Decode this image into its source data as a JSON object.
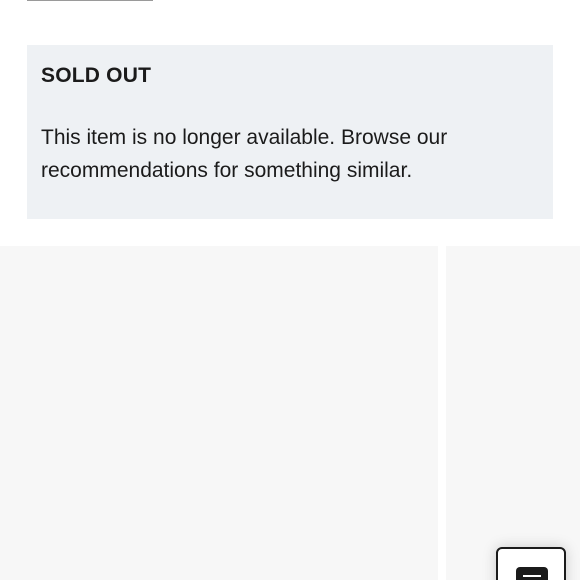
{
  "notice": {
    "title": "SOLD OUT",
    "message": "This item is no longer available. Browse our recommendations for something similar."
  },
  "recommendations": {
    "cards": [
      {
        "id": "rec-1"
      },
      {
        "id": "rec-2"
      }
    ]
  },
  "menu_button": {
    "icon": "menu-list-icon"
  },
  "colors": {
    "notice_background": "#eef1f4",
    "card_placeholder": "#f7f7f7",
    "text": "#1b1b1b"
  }
}
